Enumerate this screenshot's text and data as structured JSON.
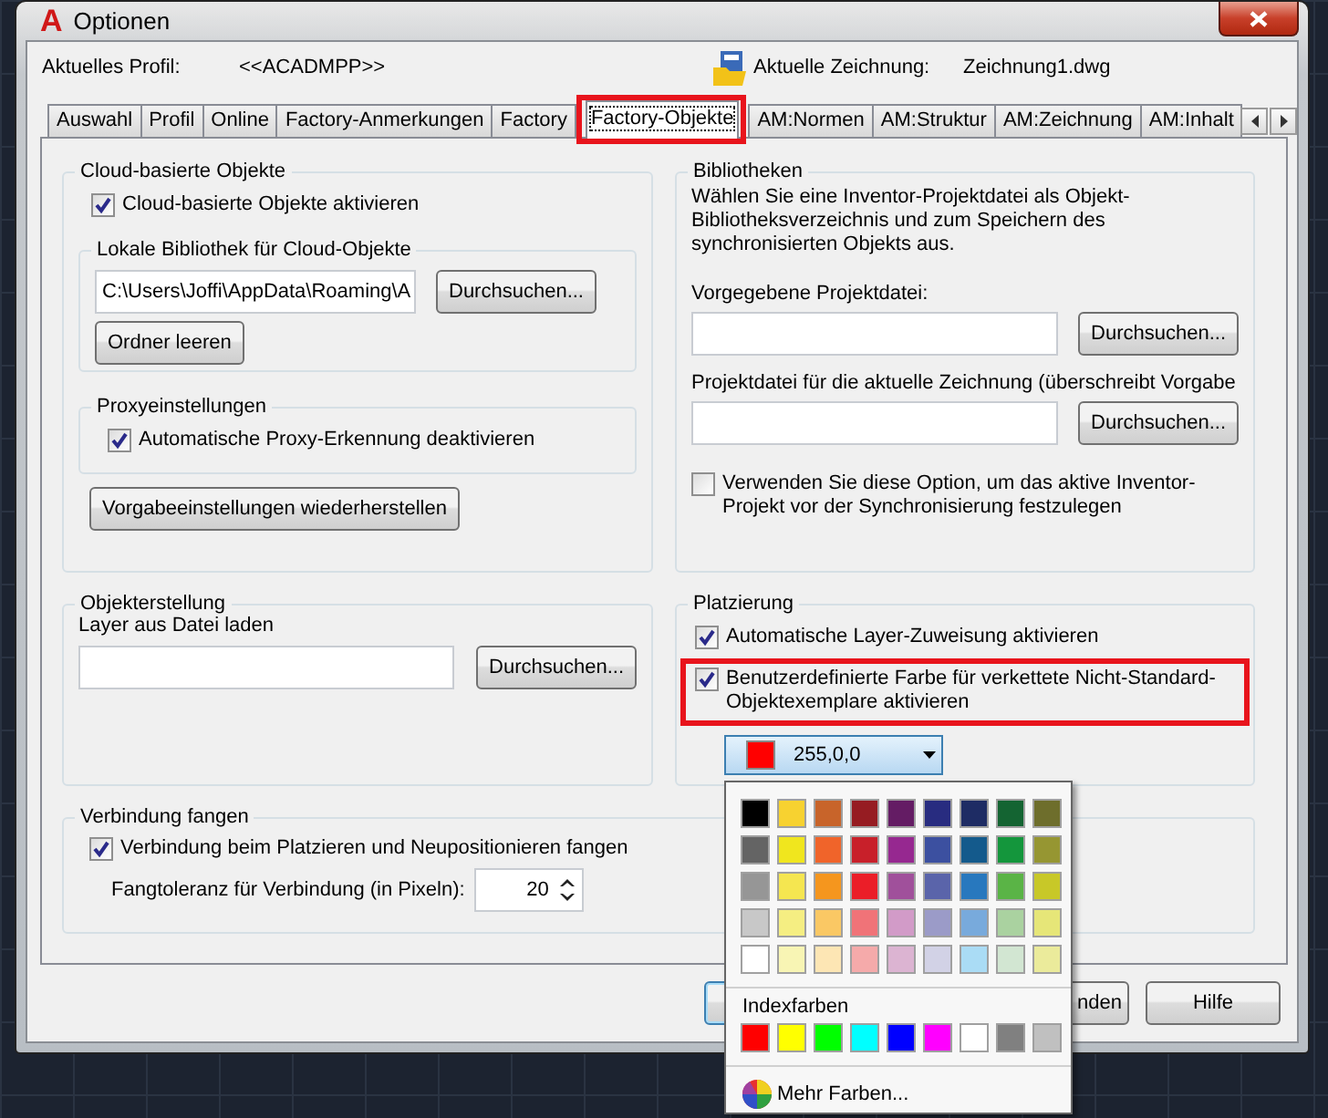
{
  "window": {
    "logo": "A",
    "title": "Optionen"
  },
  "profile": {
    "label": "Aktuelles Profil:",
    "value": "<<ACADMPP>>"
  },
  "drawing": {
    "label": "Aktuelle Zeichnung:",
    "value": "Zeichnung1.dwg"
  },
  "tabs": [
    {
      "label": "Auswahl",
      "selected": false,
      "highlighted": false
    },
    {
      "label": "Profil",
      "selected": false,
      "highlighted": false
    },
    {
      "label": "Online",
      "selected": false,
      "highlighted": false
    },
    {
      "label": "Factory-Anmerkungen",
      "selected": false,
      "highlighted": false
    },
    {
      "label": "Factory",
      "selected": false,
      "highlighted": false
    },
    {
      "label": "Factory-Objekte",
      "selected": true,
      "highlighted": true
    },
    {
      "label": "AM:Normen",
      "selected": false,
      "highlighted": false
    },
    {
      "label": "AM:Struktur",
      "selected": false,
      "highlighted": false
    },
    {
      "label": "AM:Zeichnung",
      "selected": false,
      "highlighted": false
    },
    {
      "label": "AM:Inhalt",
      "selected": false,
      "highlighted": false
    }
  ],
  "cloud": {
    "title": "Cloud-basierte Objekte",
    "enable": {
      "label": "Cloud-basierte Objekte aktivieren",
      "checked": true
    },
    "library": {
      "title": "Lokale Bibliothek für Cloud-Objekte",
      "path": "C:\\Users\\Joffi\\AppData\\Roaming\\A",
      "browse": "Durchsuchen...",
      "clear": "Ordner leeren"
    },
    "proxy": {
      "title": "Proxyeinstellungen",
      "option": {
        "label": "Automatische Proxy-Erkennung deaktivieren",
        "checked": true
      }
    },
    "reset": "Vorgabeeinstellungen wiederherstellen"
  },
  "libraries": {
    "title": "Bibliotheken",
    "description": "Wählen Sie eine Inventor-Projektdatei als Objekt-Bibliotheksverzeichnis und zum Speichern des synchronisierten Objekts aus.",
    "default_label": "Vorgegebene Projektdatei:",
    "default_browse": "Durchsuchen...",
    "current_label": "Projektdatei für die aktuelle Zeichnung (überschreibt Vorgabe",
    "current_browse": "Durchsuchen...",
    "option": {
      "label": "Verwenden Sie diese Option, um das aktive Inventor-Projekt vor der Synchronisierung festzulegen",
      "checked": false
    }
  },
  "creation": {
    "title": "Objekterstellung",
    "label": "Layer aus Datei laden",
    "browse": "Durchsuchen..."
  },
  "placement": {
    "title": "Platzierung",
    "options": [
      {
        "label": "Automatische Layer-Zuweisung aktivieren",
        "checked": true,
        "highlighted": false
      },
      {
        "label": "Benutzerdefinierte Farbe für verkettete Nicht-Standard-Objektexemplare aktivieren",
        "checked": true,
        "highlighted": true
      }
    ],
    "color_picker": {
      "value": "255,0,0",
      "color": "#ff0000",
      "expanded": true
    }
  },
  "snap": {
    "title": "Verbindung fangen",
    "option": {
      "label": "Verbindung beim Platzieren und Neupositionieren fangen",
      "checked": true
    },
    "tolerance_label": "Fangtoleranz für Verbindung (in Pixeln):",
    "tolerance": "20"
  },
  "buttons": [
    {
      "kind": "covered",
      "focused": true
    },
    {
      "kind": "partial",
      "label": "nden"
    },
    {
      "kind": "plain",
      "label": "Hilfe"
    }
  ],
  "color_menu": {
    "standard": [
      {
        "color": "#000000"
      },
      {
        "color": "#f7d230"
      },
      {
        "color": "#c8642a"
      },
      {
        "color": "#961c22"
      },
      {
        "color": "#641c64"
      },
      {
        "color": "#282c80"
      },
      {
        "color": "#1e2c64"
      },
      {
        "color": "#146432"
      },
      {
        "color": "#6e6e2c"
      },
      {
        "color": "#646464"
      },
      {
        "color": "#f0e61e"
      },
      {
        "color": "#f0642a"
      },
      {
        "color": "#c8202a"
      },
      {
        "color": "#962890"
      },
      {
        "color": "#3c50a0"
      },
      {
        "color": "#145a8c"
      },
      {
        "color": "#14963c"
      },
      {
        "color": "#969632"
      },
      {
        "color": "#969696"
      },
      {
        "color": "#f5e650"
      },
      {
        "color": "#f5961e"
      },
      {
        "color": "#eb1e28"
      },
      {
        "color": "#a0509b"
      },
      {
        "color": "#5a64aa"
      },
      {
        "color": "#2878be"
      },
      {
        "color": "#5ab446"
      },
      {
        "color": "#c8c828"
      },
      {
        "color": "#c8c8c8"
      },
      {
        "color": "#f5ee82"
      },
      {
        "color": "#fac864"
      },
      {
        "color": "#f07378"
      },
      {
        "color": "#d29bc8"
      },
      {
        "color": "#9b9bc8"
      },
      {
        "color": "#78aadc"
      },
      {
        "color": "#aad2a0"
      },
      {
        "color": "#e6e678"
      },
      {
        "color": "#ffffff"
      },
      {
        "color": "#f8f5b4"
      },
      {
        "color": "#fde6b4"
      },
      {
        "color": "#f5aaaa"
      },
      {
        "color": "#dcb4d2"
      },
      {
        "color": "#d2d2e6"
      },
      {
        "color": "#aadcf5"
      },
      {
        "color": "#d2e6d2"
      },
      {
        "color": "#ebeb9b"
      }
    ],
    "index_title": "Indexfarben",
    "index": [
      {
        "color": "#ff0000"
      },
      {
        "color": "#ffff00"
      },
      {
        "color": "#00ff00"
      },
      {
        "color": "#00ffff"
      },
      {
        "color": "#0000ff"
      },
      {
        "color": "#ff00ff"
      },
      {
        "color": "#ffffff"
      },
      {
        "color": "#808080"
      },
      {
        "color": "#c0c0c0"
      }
    ],
    "more": "Mehr Farben..."
  }
}
